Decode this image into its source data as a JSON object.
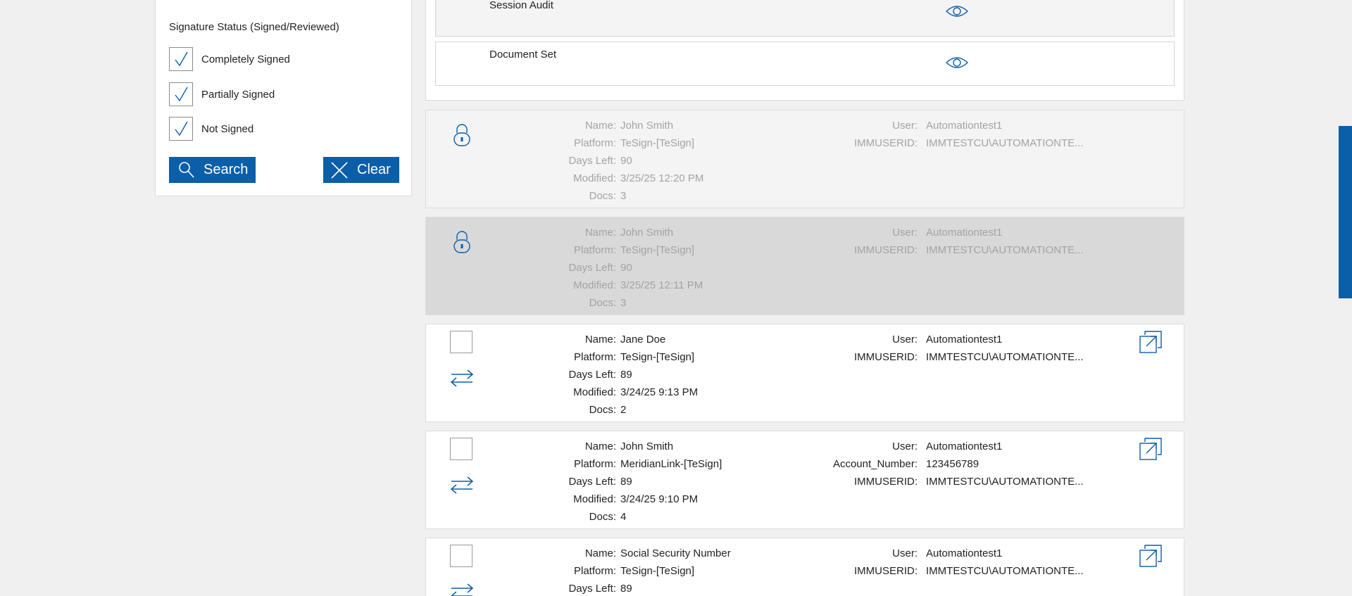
{
  "filter": {
    "title": "Signature Status (Signed/Reviewed)",
    "options": [
      {
        "label": "Completely Signed",
        "checked": true
      },
      {
        "label": "Partially Signed",
        "checked": true
      },
      {
        "label": "Not Signed",
        "checked": true
      }
    ],
    "search_label": "Search",
    "clear_label": "Clear"
  },
  "documents": [
    {
      "name": "Session Audit",
      "icon": "eye-icon"
    },
    {
      "name": "Document Set",
      "icon": "eye-icon"
    }
  ],
  "labels": {
    "name": "Name:",
    "platform": "Platform:",
    "days_left": "Days Left:",
    "modified": "Modified:",
    "docs": "Docs:",
    "user": "User:",
    "account_number": "Account_Number:",
    "immuserid": "IMMUSERID:"
  },
  "packets": [
    {
      "locked": true,
      "name": "John Smith",
      "platform": "TeSign-[TeSign]",
      "days_left": "90",
      "modified": "3/25/25 12:20 PM",
      "docs": "3",
      "user": "Automationtest1",
      "immuserid": "IMMTESTCU\\AUTOMATIONTE..."
    },
    {
      "locked": true,
      "name": "John Smith",
      "platform": "TeSign-[TeSign]",
      "days_left": "90",
      "modified": "3/25/25 12:11 PM",
      "docs": "3",
      "user": "Automationtest1",
      "immuserid": "IMMTESTCU\\AUTOMATIONTE..."
    },
    {
      "locked": false,
      "name": "Jane Doe",
      "platform": "TeSign-[TeSign]",
      "days_left": "89",
      "modified": "3/24/25 9:13 PM",
      "docs": "2",
      "user": "Automationtest1",
      "immuserid": "IMMTESTCU\\AUTOMATIONTE..."
    },
    {
      "locked": false,
      "name": "John Smith",
      "platform": "MeridianLink-[TeSign]",
      "days_left": "89",
      "modified": "3/24/25 9:10 PM",
      "docs": "4",
      "user": "Automationtest1",
      "account_number": "123456789",
      "immuserid": "IMMTESTCU\\AUTOMATIONTE..."
    },
    {
      "locked": false,
      "name": "Social Security Number",
      "platform": "TeSign-[TeSign]",
      "days_left": "89",
      "user": "Automationtest1",
      "immuserid": "IMMTESTCU\\AUTOMATIONTE..."
    }
  ],
  "colors": {
    "accent": "#0b5ea8",
    "locked_text": "#a3a3a3",
    "selected_row": "#d9d9d9"
  }
}
